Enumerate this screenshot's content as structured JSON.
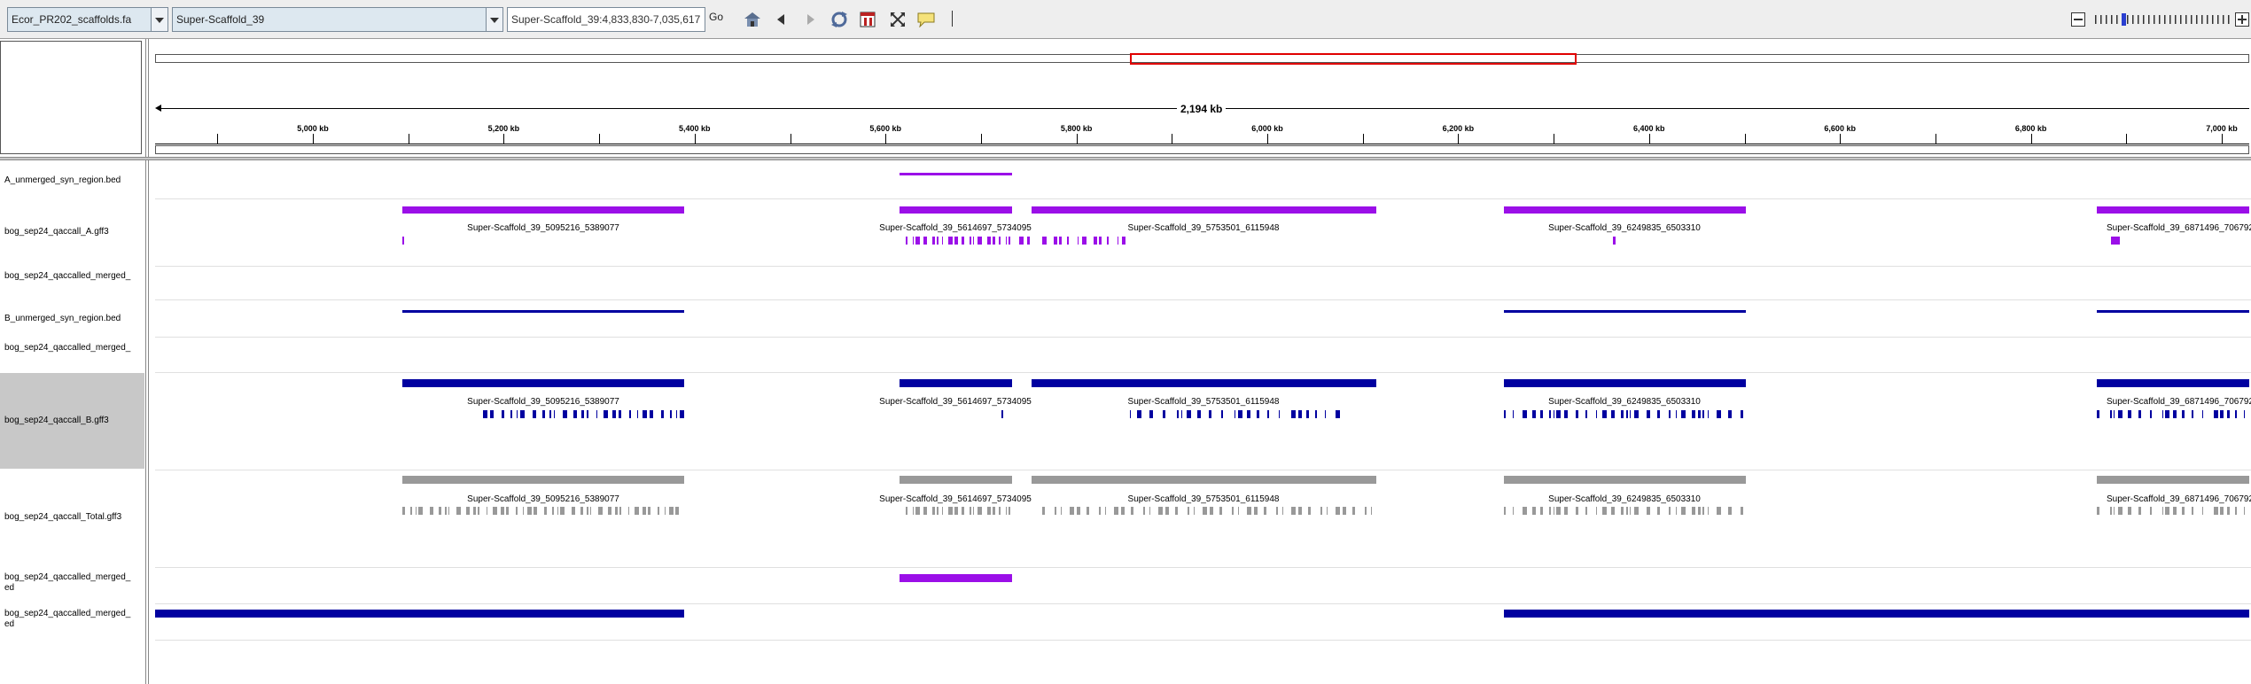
{
  "toolbar": {
    "genome": "Ecor_PR202_scaffolds.fa",
    "chromosome": "Super-Scaffold_39",
    "locus": "Super-Scaffold_39:4,833,830-7,035,617",
    "go_label": "Go",
    "icons": [
      "home-icon",
      "back-icon",
      "forward-icon",
      "refresh-icon",
      "region-of-interest-icon",
      "resize-icon",
      "popup-text-icon",
      "divider",
      "zoom-out-icon",
      "zoom-slider",
      "zoom-in-icon"
    ]
  },
  "ruler": {
    "span_label": "2,194 kb",
    "tick_labels": [
      "5,000 kb",
      "5,200 kb",
      "5,400 kb",
      "5,600 kb",
      "5,800 kb",
      "6,000 kb",
      "6,200 kb",
      "6,400 kb",
      "6,600 kb",
      "6,800 kb",
      "7,000 kb"
    ]
  },
  "colors": {
    "purple": "#9b0fe8",
    "blue": "#0000a0",
    "gray": "#999999",
    "ideogram_highlight": "#e00000"
  },
  "features": {
    "labels": [
      "Super-Scaffold_39_5095216_5389077",
      "Super-Scaffold_39_5614697_5734095",
      "Super-Scaffold_39_5753501_6115948",
      "Super-Scaffold_39_6249835_6503310",
      "Super-Scaffold_39_6871496_706792"
    ]
  },
  "tracks": [
    {
      "name": "A_unmerged_syn_region.bed"
    },
    {
      "name": "bog_sep24_qaccall_A.gff3"
    },
    {
      "name": "bog_sep24_qaccalled_merged_"
    },
    {
      "name": "B_unmerged_syn_region.bed"
    },
    {
      "name": "bog_sep24_qaccalled_merged_"
    },
    {
      "name": "bog_sep24_qaccall_B.gff3"
    },
    {
      "name": "bog_sep24_qaccall_Total.gff3"
    },
    {
      "name": "bog_sep24_qaccalled_merged_",
      "name2": "ed"
    },
    {
      "name": "bog_sep24_qaccalled_merged_",
      "name2": "ed"
    }
  ]
}
